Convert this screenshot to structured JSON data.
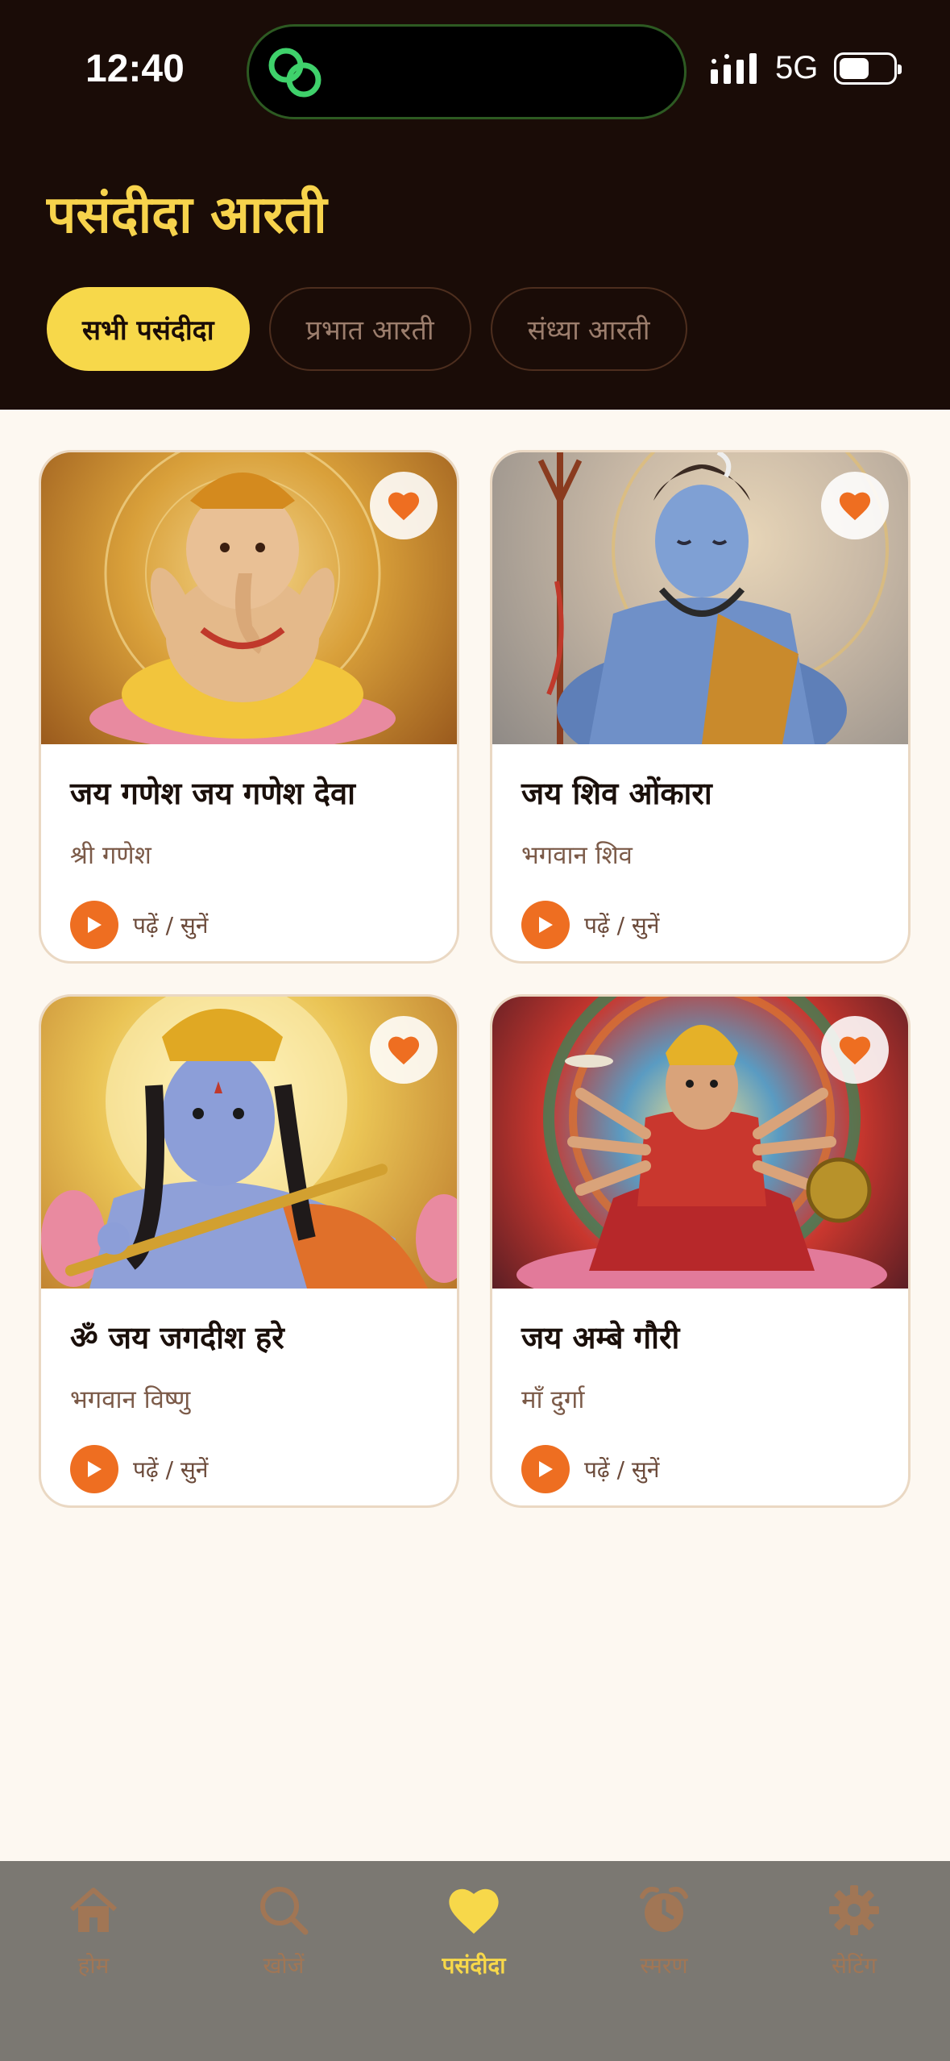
{
  "status_bar": {
    "time": "12:40",
    "network": "5G",
    "battery_level": 0.55
  },
  "header": {
    "title": "पसंदीदा आरती"
  },
  "tabs": [
    {
      "label": "सभी पसंदीदा",
      "active": true
    },
    {
      "label": "प्रभात आरती",
      "active": false
    },
    {
      "label": "संध्या आरती",
      "active": false
    }
  ],
  "cards": [
    {
      "title": "जय गणेश जय गणेश देवा",
      "deity": "श्री गणेश",
      "action": "पढ़ें / सुनें",
      "favorite": true,
      "image": "ganesh-art"
    },
    {
      "title": "जय शिव ओंकारा",
      "deity": "भगवान शिव",
      "action": "पढ़ें / सुनें",
      "favorite": true,
      "image": "shiva-art"
    },
    {
      "title": "ॐ जय जगदीश हरे",
      "deity": "भगवान विष्णु",
      "action": "पढ़ें / सुनें",
      "favorite": true,
      "image": "krishna-art"
    },
    {
      "title": "जय अम्बे गौरी",
      "deity": "माँ दुर्गा",
      "action": "पढ़ें / सुनें",
      "favorite": true,
      "image": "durga-art"
    }
  ],
  "nav": [
    {
      "label": "होम",
      "icon": "home-icon"
    },
    {
      "label": "खोजें",
      "icon": "search-icon"
    },
    {
      "label": "पसंदीदा",
      "icon": "heart-icon",
      "active": true
    },
    {
      "label": "स्मरण",
      "icon": "alarm-clock-icon"
    },
    {
      "label": "सेटिंग",
      "icon": "gear-icon"
    }
  ],
  "colors": {
    "header_bg": "#1a0c07",
    "accent_yellow": "#f7d84a",
    "accent_orange": "#ee6e21",
    "page_bg": "#fdf8f1",
    "nav_bg": "#7b7872"
  }
}
